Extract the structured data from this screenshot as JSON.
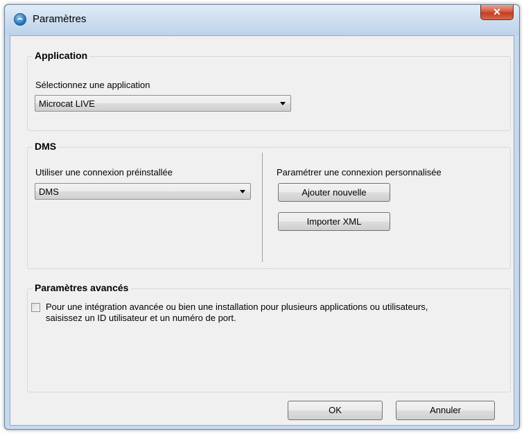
{
  "window": {
    "title": "Paramètres",
    "close_label": "✕"
  },
  "application": {
    "legend": "Application",
    "select_label": "Sélectionnez une application",
    "selected": "Microcat LIVE"
  },
  "dms": {
    "legend": "DMS",
    "preinstalled_label": "Utiliser une connexion préinstallée",
    "preinstalled_selected": "DMS",
    "custom_label": "Paramétrer une connexion personnalisée",
    "add_new_button": "Ajouter nouvelle",
    "import_xml_button": "Importer XML"
  },
  "advanced": {
    "legend": "Paramètres avancés",
    "checkbox_text_line1": "Pour une intégration avancée ou bien une installation pour plusieurs applications ou utilisateurs,",
    "checkbox_text_line2": "saisissez un ID utilisateur et un numéro de port.",
    "checked": false
  },
  "footer": {
    "ok_button": "OK",
    "cancel_button": "Annuler"
  },
  "icons": {
    "app": "globe-icon",
    "close": "close-icon",
    "dropdown": "chevron-down-icon"
  }
}
